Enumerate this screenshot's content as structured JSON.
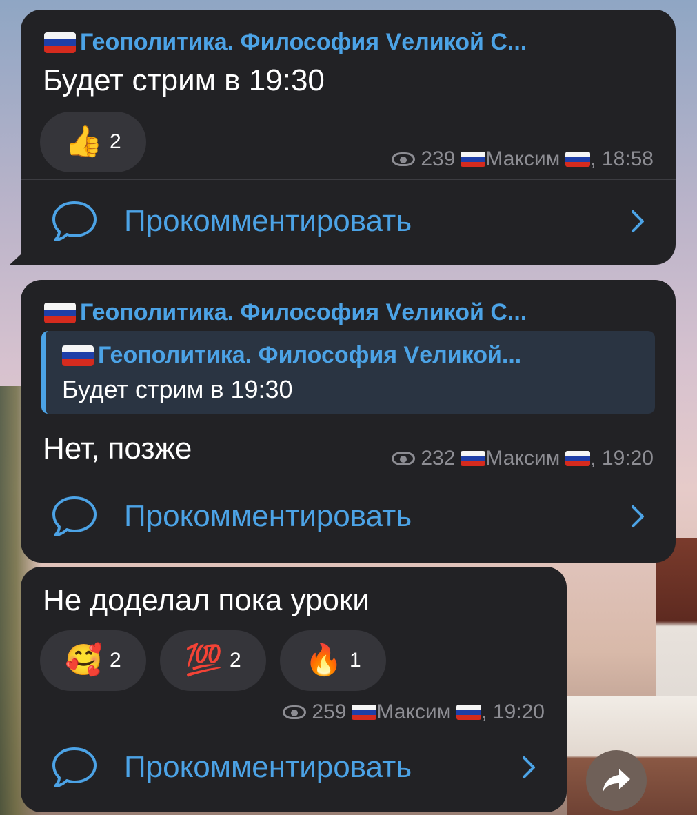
{
  "channel": {
    "name": "Геополитика. Философия Vеликой С...",
    "flag_icon": "russian-flag-icon"
  },
  "messages": [
    {
      "author": "Геополитика. Философия Vеликой С...",
      "text": "Будет стрим в 19:30",
      "reactions": [
        {
          "emoji": "👍",
          "icon": "thumbs-up-icon",
          "count": "2"
        }
      ],
      "views": "239",
      "signature": "Максим",
      "time": ", 18:58",
      "comment_label": "Прокомментировать"
    },
    {
      "author": "Геополитика. Философия Vеликой С...",
      "reply": {
        "author": "Геополитика. Философия Vеликой...",
        "text": "Будет стрим в 19:30"
      },
      "text": "Нет, позже",
      "views": "232",
      "signature": "Максим",
      "time": ", 19:20",
      "comment_label": "Прокомментировать"
    },
    {
      "text": "Не доделал пока уроки",
      "reactions": [
        {
          "emoji": "🥰",
          "icon": "smiling-hearts-icon",
          "count": "2"
        },
        {
          "emoji": "💯",
          "icon": "hundred-points-icon",
          "count": "2"
        },
        {
          "emoji": "🔥",
          "icon": "fire-icon",
          "count": "1"
        }
      ],
      "views": "259",
      "signature": "Максим",
      "time": ", 19:20",
      "comment_label": "Прокомментировать"
    }
  ],
  "colors": {
    "bubble": "#222225",
    "accent": "#4ca3e6",
    "meta": "#8d8d93",
    "reaction_bg": "#35353a"
  },
  "share_button_icon": "share-arrow-icon"
}
